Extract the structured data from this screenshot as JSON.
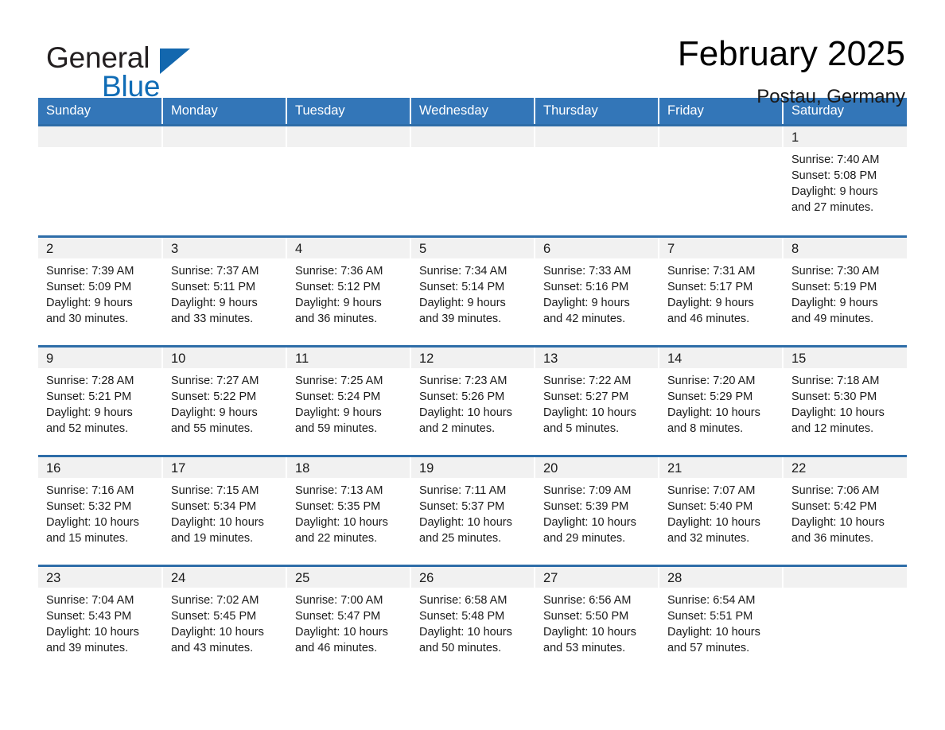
{
  "brand": {
    "name_part1": "General",
    "name_part2": "Blue",
    "accent_color": "#0f6cb6",
    "triangle_color": "#1367ae"
  },
  "header": {
    "month_title": "February 2025",
    "location": "Postau, Germany"
  },
  "theme": {
    "header_row_bg": "#3376b8",
    "row_divider": "#2e6da8",
    "daynum_band_bg": "#f1f1f1",
    "page_bg": "#ffffff"
  },
  "weekdays": [
    "Sunday",
    "Monday",
    "Tuesday",
    "Wednesday",
    "Thursday",
    "Friday",
    "Saturday"
  ],
  "weeks": [
    [
      {
        "day": "",
        "sunrise": "",
        "sunset": "",
        "daylight": "",
        "empty": true
      },
      {
        "day": "",
        "sunrise": "",
        "sunset": "",
        "daylight": "",
        "empty": true
      },
      {
        "day": "",
        "sunrise": "",
        "sunset": "",
        "daylight": "",
        "empty": true
      },
      {
        "day": "",
        "sunrise": "",
        "sunset": "",
        "daylight": "",
        "empty": true
      },
      {
        "day": "",
        "sunrise": "",
        "sunset": "",
        "daylight": "",
        "empty": true
      },
      {
        "day": "",
        "sunrise": "",
        "sunset": "",
        "daylight": "",
        "empty": true
      },
      {
        "day": "1",
        "sunrise": "Sunrise: 7:40 AM",
        "sunset": "Sunset: 5:08 PM",
        "daylight": "Daylight: 9 hours and 27 minutes."
      }
    ],
    [
      {
        "day": "2",
        "sunrise": "Sunrise: 7:39 AM",
        "sunset": "Sunset: 5:09 PM",
        "daylight": "Daylight: 9 hours and 30 minutes."
      },
      {
        "day": "3",
        "sunrise": "Sunrise: 7:37 AM",
        "sunset": "Sunset: 5:11 PM",
        "daylight": "Daylight: 9 hours and 33 minutes."
      },
      {
        "day": "4",
        "sunrise": "Sunrise: 7:36 AM",
        "sunset": "Sunset: 5:12 PM",
        "daylight": "Daylight: 9 hours and 36 minutes."
      },
      {
        "day": "5",
        "sunrise": "Sunrise: 7:34 AM",
        "sunset": "Sunset: 5:14 PM",
        "daylight": "Daylight: 9 hours and 39 minutes."
      },
      {
        "day": "6",
        "sunrise": "Sunrise: 7:33 AM",
        "sunset": "Sunset: 5:16 PM",
        "daylight": "Daylight: 9 hours and 42 minutes."
      },
      {
        "day": "7",
        "sunrise": "Sunrise: 7:31 AM",
        "sunset": "Sunset: 5:17 PM",
        "daylight": "Daylight: 9 hours and 46 minutes."
      },
      {
        "day": "8",
        "sunrise": "Sunrise: 7:30 AM",
        "sunset": "Sunset: 5:19 PM",
        "daylight": "Daylight: 9 hours and 49 minutes."
      }
    ],
    [
      {
        "day": "9",
        "sunrise": "Sunrise: 7:28 AM",
        "sunset": "Sunset: 5:21 PM",
        "daylight": "Daylight: 9 hours and 52 minutes."
      },
      {
        "day": "10",
        "sunrise": "Sunrise: 7:27 AM",
        "sunset": "Sunset: 5:22 PM",
        "daylight": "Daylight: 9 hours and 55 minutes."
      },
      {
        "day": "11",
        "sunrise": "Sunrise: 7:25 AM",
        "sunset": "Sunset: 5:24 PM",
        "daylight": "Daylight: 9 hours and 59 minutes."
      },
      {
        "day": "12",
        "sunrise": "Sunrise: 7:23 AM",
        "sunset": "Sunset: 5:26 PM",
        "daylight": "Daylight: 10 hours and 2 minutes."
      },
      {
        "day": "13",
        "sunrise": "Sunrise: 7:22 AM",
        "sunset": "Sunset: 5:27 PM",
        "daylight": "Daylight: 10 hours and 5 minutes."
      },
      {
        "day": "14",
        "sunrise": "Sunrise: 7:20 AM",
        "sunset": "Sunset: 5:29 PM",
        "daylight": "Daylight: 10 hours and 8 minutes."
      },
      {
        "day": "15",
        "sunrise": "Sunrise: 7:18 AM",
        "sunset": "Sunset: 5:30 PM",
        "daylight": "Daylight: 10 hours and 12 minutes."
      }
    ],
    [
      {
        "day": "16",
        "sunrise": "Sunrise: 7:16 AM",
        "sunset": "Sunset: 5:32 PM",
        "daylight": "Daylight: 10 hours and 15 minutes."
      },
      {
        "day": "17",
        "sunrise": "Sunrise: 7:15 AM",
        "sunset": "Sunset: 5:34 PM",
        "daylight": "Daylight: 10 hours and 19 minutes."
      },
      {
        "day": "18",
        "sunrise": "Sunrise: 7:13 AM",
        "sunset": "Sunset: 5:35 PM",
        "daylight": "Daylight: 10 hours and 22 minutes."
      },
      {
        "day": "19",
        "sunrise": "Sunrise: 7:11 AM",
        "sunset": "Sunset: 5:37 PM",
        "daylight": "Daylight: 10 hours and 25 minutes."
      },
      {
        "day": "20",
        "sunrise": "Sunrise: 7:09 AM",
        "sunset": "Sunset: 5:39 PM",
        "daylight": "Daylight: 10 hours and 29 minutes."
      },
      {
        "day": "21",
        "sunrise": "Sunrise: 7:07 AM",
        "sunset": "Sunset: 5:40 PM",
        "daylight": "Daylight: 10 hours and 32 minutes."
      },
      {
        "day": "22",
        "sunrise": "Sunrise: 7:06 AM",
        "sunset": "Sunset: 5:42 PM",
        "daylight": "Daylight: 10 hours and 36 minutes."
      }
    ],
    [
      {
        "day": "23",
        "sunrise": "Sunrise: 7:04 AM",
        "sunset": "Sunset: 5:43 PM",
        "daylight": "Daylight: 10 hours and 39 minutes."
      },
      {
        "day": "24",
        "sunrise": "Sunrise: 7:02 AM",
        "sunset": "Sunset: 5:45 PM",
        "daylight": "Daylight: 10 hours and 43 minutes."
      },
      {
        "day": "25",
        "sunrise": "Sunrise: 7:00 AM",
        "sunset": "Sunset: 5:47 PM",
        "daylight": "Daylight: 10 hours and 46 minutes."
      },
      {
        "day": "26",
        "sunrise": "Sunrise: 6:58 AM",
        "sunset": "Sunset: 5:48 PM",
        "daylight": "Daylight: 10 hours and 50 minutes."
      },
      {
        "day": "27",
        "sunrise": "Sunrise: 6:56 AM",
        "sunset": "Sunset: 5:50 PM",
        "daylight": "Daylight: 10 hours and 53 minutes."
      },
      {
        "day": "28",
        "sunrise": "Sunrise: 6:54 AM",
        "sunset": "Sunset: 5:51 PM",
        "daylight": "Daylight: 10 hours and 57 minutes."
      },
      {
        "day": "",
        "sunrise": "",
        "sunset": "",
        "daylight": "",
        "empty": true
      }
    ]
  ]
}
